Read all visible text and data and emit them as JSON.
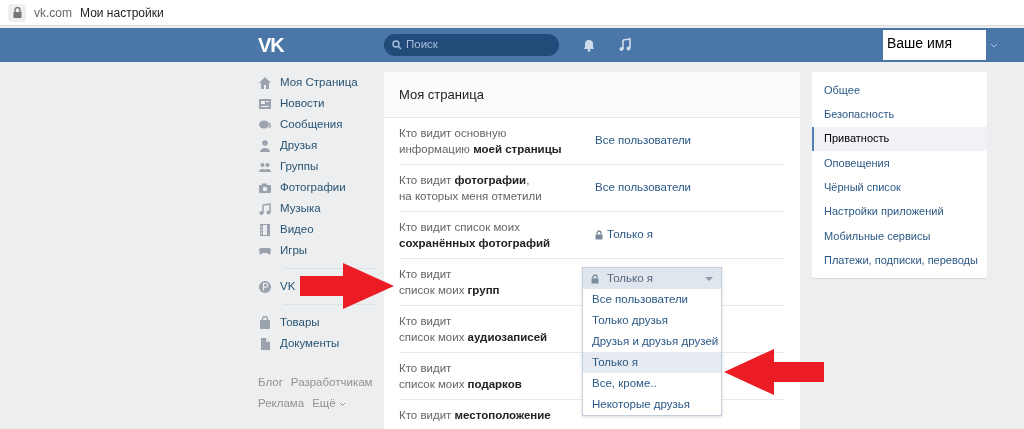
{
  "browser": {
    "url": "vk.com",
    "title": "Мои настройки"
  },
  "header": {
    "logo": "VK",
    "search_placeholder": "Поиск",
    "user_name": "Ваше имя"
  },
  "left_nav": {
    "groups": [
      [
        {
          "label": "Моя Страница"
        },
        {
          "label": "Новости"
        },
        {
          "label": "Сообщения"
        },
        {
          "label": "Друзья"
        },
        {
          "label": "Группы"
        },
        {
          "label": "Фотографии"
        },
        {
          "label": "Музыка"
        },
        {
          "label": "Видео"
        },
        {
          "label": "Игры"
        }
      ],
      [
        {
          "label": "VK"
        }
      ],
      [
        {
          "label": "Товары"
        },
        {
          "label": "Документы"
        }
      ]
    ],
    "footer_links": [
      "Блог",
      "Разработчикам",
      "Реклама",
      "Ещё"
    ]
  },
  "settings": {
    "title": "Моя страница",
    "rows": [
      {
        "lines": [
          "Кто видит основную",
          "информацию **моей страницы**"
        ],
        "value": "Все пользователи",
        "locked": false,
        "expanded": false
      },
      {
        "lines": [
          "Кто видит **фотографии**,",
          "на которых меня отметили"
        ],
        "value": "Все пользователи",
        "locked": false,
        "expanded": false
      },
      {
        "lines": [
          "Кто видит список моих",
          "**сохранённых фотографий**"
        ],
        "value": "Только я",
        "locked": true,
        "expanded": false
      },
      {
        "lines": [
          "Кто видит",
          "список моих **групп**"
        ],
        "value": "Только я",
        "locked": true,
        "expanded": true,
        "options": [
          {
            "label": "Все пользователи",
            "selected": false
          },
          {
            "label": "Только друзья",
            "selected": false
          },
          {
            "label": "Друзья и друзья друзей",
            "selected": false
          },
          {
            "label": "Только я",
            "selected": true
          },
          {
            "label": "Все, кроме..",
            "selected": false
          },
          {
            "label": "Некоторые друзья",
            "selected": false
          }
        ]
      },
      {
        "lines": [
          "Кто видит",
          "список моих **аудиозаписей**"
        ],
        "locked": false,
        "expanded": false
      },
      {
        "lines": [
          "Кто видит",
          "список моих **подарков**"
        ],
        "locked": false,
        "expanded": false
      },
      {
        "lines": [
          "Кто видит **местоположение**"
        ],
        "locked": false,
        "expanded": false
      }
    ]
  },
  "right_menu": [
    {
      "label": "Общее",
      "selected": false
    },
    {
      "label": "Безопасность",
      "selected": false
    },
    {
      "label": "Приватность",
      "selected": true
    },
    {
      "label": "Оповещения",
      "selected": false
    },
    {
      "label": "Чёрный список",
      "selected": false
    },
    {
      "label": "Настройки приложений",
      "selected": false
    },
    {
      "label": "Мобильные сервисы",
      "selected": false
    },
    {
      "label": "Платежи, подписки, переводы",
      "selected": false
    }
  ]
}
